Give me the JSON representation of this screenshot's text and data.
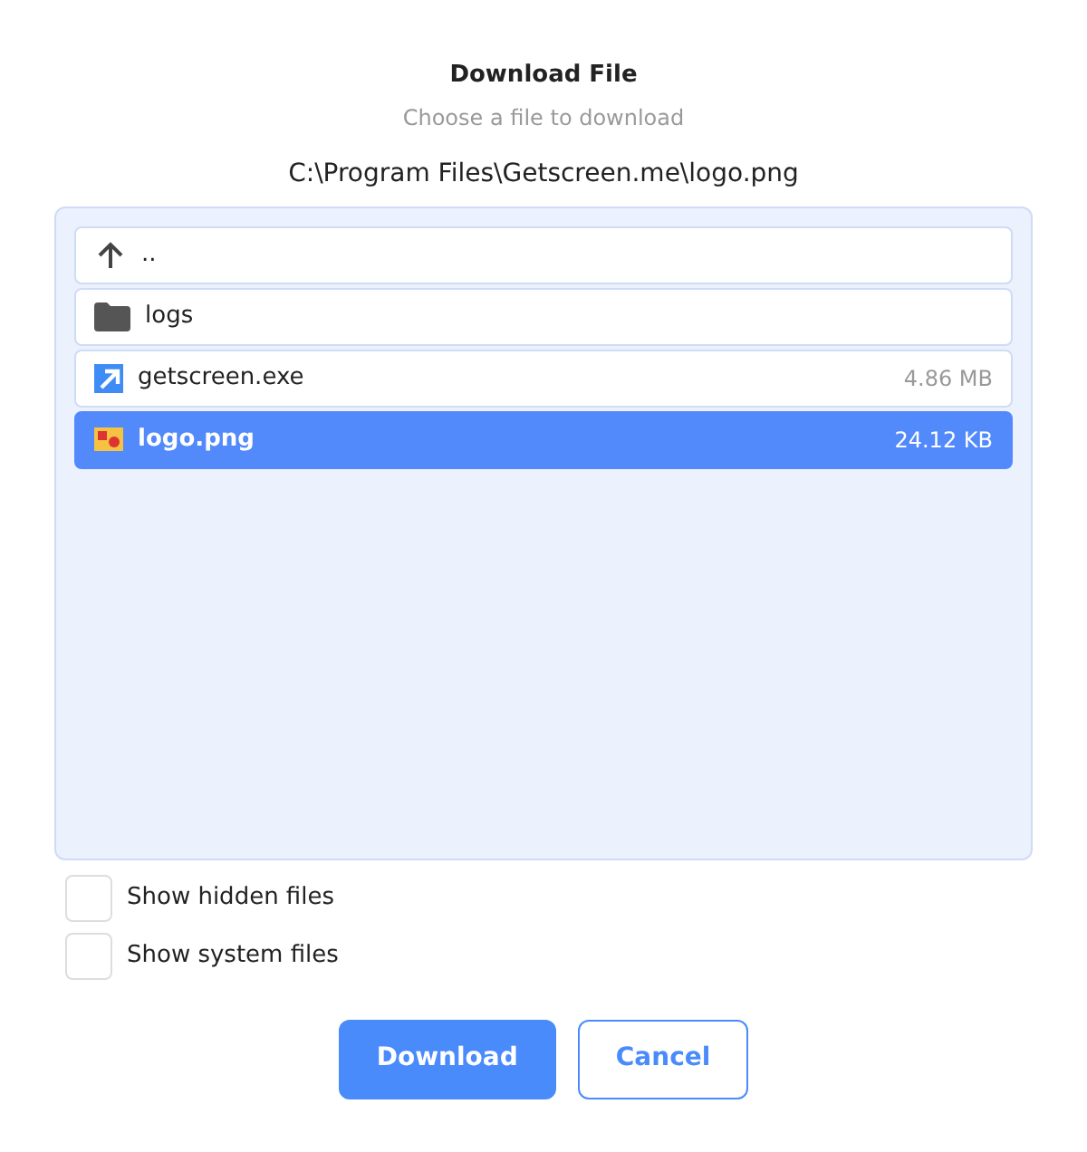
{
  "dialog": {
    "title": "Download File",
    "subtitle": "Choose a file to download",
    "path": "C:\\Program Files\\Getscreen.me\\logo.png"
  },
  "files": [
    {
      "kind": "up",
      "name": "..",
      "selected": false
    },
    {
      "kind": "folder",
      "name": "logs",
      "selected": false
    },
    {
      "kind": "shortcut",
      "name": "getscreen.exe",
      "size": "4.86 MB",
      "selected": false
    },
    {
      "kind": "image",
      "name": "logo.png",
      "size": "24.12 KB",
      "selected": true
    }
  ],
  "options": [
    {
      "label": "Show hidden files",
      "checked": false
    },
    {
      "label": "Show system files",
      "checked": false
    }
  ],
  "buttons": [
    {
      "kind": "primary",
      "label": "Download"
    },
    {
      "kind": "secondary",
      "label": "Cancel"
    }
  ]
}
